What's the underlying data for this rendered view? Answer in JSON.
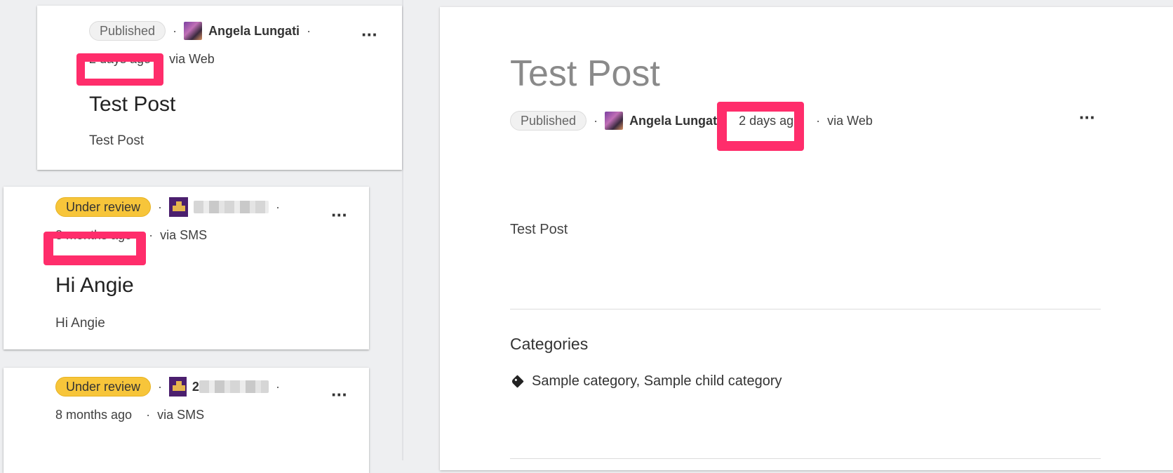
{
  "posts": [
    {
      "status": "Published",
      "author": "Angela Lungati",
      "time": "2 days ago",
      "source": "via Web",
      "title": "Test Post",
      "excerpt": "Test Post",
      "more_icon": "ellipsis-icon"
    },
    {
      "status": "Under review",
      "author_prefix": "",
      "time": "8 months ago",
      "source": "via SMS",
      "title": "Hi Angie",
      "excerpt": "Hi Angie",
      "more_icon": "ellipsis-icon"
    },
    {
      "status": "Under review",
      "author_prefix": "2",
      "time": "8 months ago",
      "source": "via SMS",
      "more_icon": "ellipsis-icon"
    }
  ],
  "detail": {
    "title": "Test Post",
    "status": "Published",
    "author": "Angela Lungati",
    "time": "2 days ago",
    "source": "via Web",
    "body": "Test Post",
    "categories_heading": "Categories",
    "categories": "Sample category, Sample child category"
  },
  "separator": "·",
  "more_glyph": "···",
  "colors": {
    "highlight": "#ff2d6b",
    "review_badge": "#f7c53a",
    "published_badge": "#f1f1f1"
  }
}
